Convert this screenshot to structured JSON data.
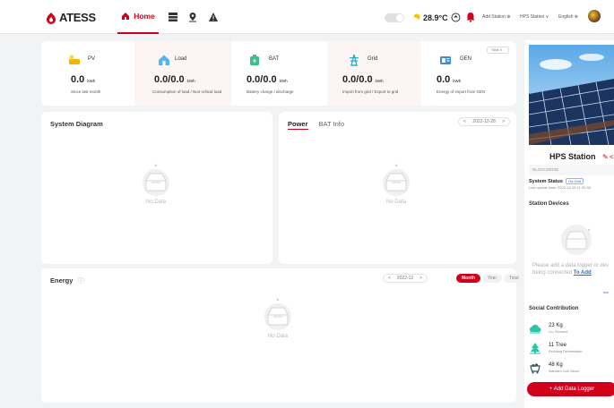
{
  "brand": {
    "name": "ATESS",
    "accent": "#d0021b"
  },
  "nav": {
    "home_label": "Home",
    "icons": [
      "grid-icon",
      "location-pin-icon",
      "warning-icon"
    ]
  },
  "topbar": {
    "temperature": "28.9°C",
    "add_station_label": "Add Station ⊕",
    "station_selector": "HPS Station ∨",
    "language": "English ⊕"
  },
  "stats": [
    {
      "name": "PV",
      "value": "0.0",
      "unit": "kWh",
      "sub": "Since last month"
    },
    {
      "name": "Load",
      "value": "0.0/0.0",
      "unit": "kWh",
      "sub": "Consumption of load / Non-critical load"
    },
    {
      "name": "BAT",
      "value": "0.0/0.0",
      "unit": "kWh",
      "sub": "Battery charge / discharge"
    },
    {
      "name": "Grid",
      "value": "0.0/0.0",
      "unit": "kWh",
      "sub": "Import from grid / Export to grid"
    },
    {
      "name": "GEN",
      "value": "0.0",
      "unit": "kWh",
      "sub": "Energy of import from GEN"
    }
  ],
  "stats_period": "Total ∨",
  "system_diagram": {
    "title": "System Diagram",
    "empty_text": "No Data"
  },
  "power": {
    "tab_power": "Power",
    "tab_bat": "BAT Info",
    "date": "2022-12-28",
    "empty_text": "No Data",
    "prev": "<",
    "next": ">"
  },
  "energy": {
    "title": "Energy",
    "date": "2022-12",
    "prev": "<",
    "next": ">",
    "periods": [
      "Month",
      "Year",
      "Total"
    ],
    "empty_text": "No Data"
  },
  "station": {
    "name": "HPS Station",
    "serial": "NLG0C29G0B",
    "status_label": "System Status",
    "status_value": "On-Grid",
    "last_update": "Last update date: 2022-12-15 11:20:35",
    "devices_title": "Station Devices",
    "devices_msg_1": "Please add a data logger or dev",
    "devices_msg_2": "being connected",
    "add_link": "To Add",
    "more": "ma",
    "social_title": "Social Contribution",
    "contributions": [
      {
        "value": "23 Kg",
        "label": "Co₂ Reduced"
      },
      {
        "value": "11 Tree",
        "label": "Reducing Deforestation"
      },
      {
        "value": "48 Kg",
        "label": "Standard Coal Saved"
      }
    ],
    "add_logger_label": "+ Add Data Logger"
  }
}
